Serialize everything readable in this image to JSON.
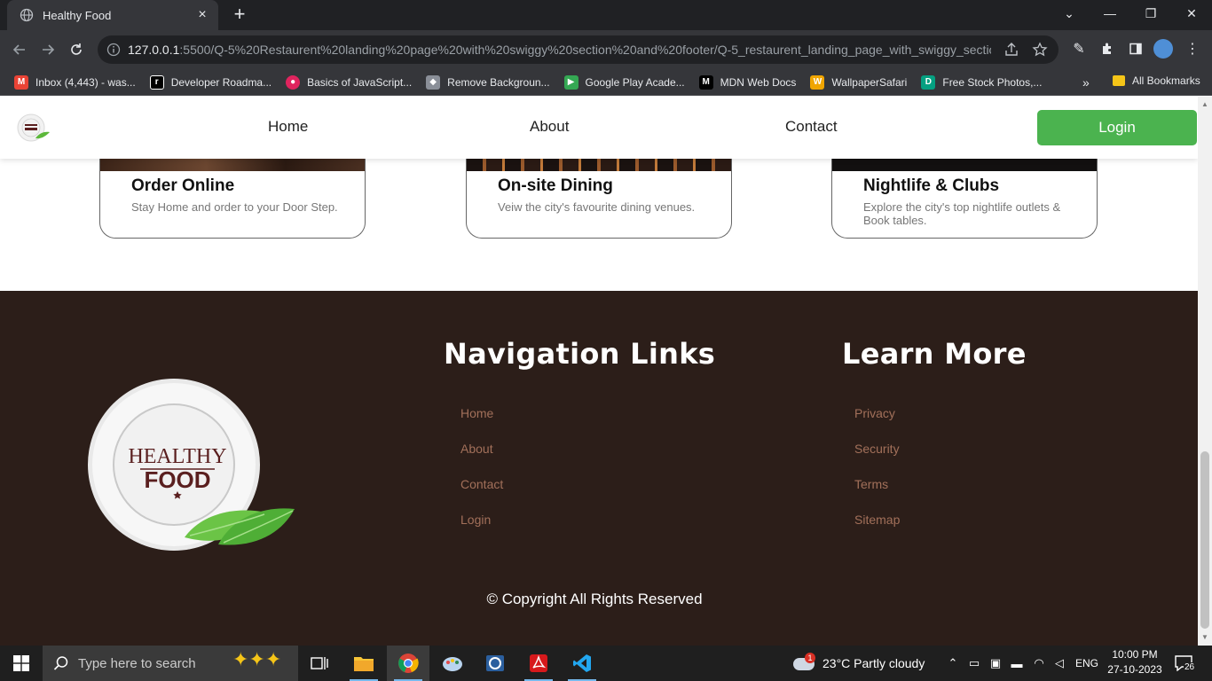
{
  "browser": {
    "tab_title": "Healthy Food",
    "url_host": "127.0.0.1",
    "url_rest": ":5500/Q-5%20Restaurent%20landing%20page%20with%20swiggy%20section%20and%20footer/Q-5_restaurent_landing_page_with_swiggy_section_...",
    "bookmarks": [
      {
        "label": "Inbox (4,443) - was...",
        "icon": "gmail-icon",
        "color": "#ea4335"
      },
      {
        "label": "Developer Roadma...",
        "icon": "roadmap-icon",
        "color": "#000000"
      },
      {
        "label": "Basics of JavaScript...",
        "icon": "js-basics-icon",
        "color": "#e0245e"
      },
      {
        "label": "Remove Backgroun...",
        "icon": "removebg-icon",
        "color": "#8a8f98"
      },
      {
        "label": "Google Play Acade...",
        "icon": "google-play-icon",
        "color": "#34a853"
      },
      {
        "label": "MDN Web Docs",
        "icon": "mdn-icon",
        "color": "#000000"
      },
      {
        "label": "WallpaperSafari",
        "icon": "wallpapersafari-icon",
        "color": "#f0a500"
      },
      {
        "label": "Free Stock Photos,...",
        "icon": "stock-photos-icon",
        "color": "#05a081"
      }
    ],
    "all_bookmarks": "All Bookmarks"
  },
  "site": {
    "nav": {
      "home": "Home",
      "about": "About",
      "contact": "Contact",
      "login": "Login"
    },
    "cards": [
      {
        "title": "Order Online",
        "desc": "Stay Home and order to your Door Step."
      },
      {
        "title": "On-site Dining",
        "desc": "Veiw the city's favourite dining venues."
      },
      {
        "title": "Nightlife & Clubs",
        "desc": "Explore the city's top nightlife outlets & Book tables."
      }
    ],
    "footer": {
      "logo_line1": "HEALTHY",
      "logo_line2": "FOOD",
      "nav_heading": "Navigation Links",
      "nav_links": [
        "Home",
        "About",
        "Contact",
        "Login"
      ],
      "learn_heading": "Learn More",
      "learn_links": [
        "Privacy",
        "Security",
        "Terms",
        "Sitemap"
      ],
      "copyright": "© Copyright All Rights Reserved"
    }
  },
  "taskbar": {
    "search_placeholder": "Type here to search",
    "weather": "23°C  Partly cloudy",
    "weather_badge": "1",
    "lang": "ENG",
    "time": "10:00 PM",
    "date": "27-10-2023",
    "notif_count": "26"
  },
  "colors": {
    "login_green": "#4bb34f",
    "footer_bg": "#2c1e19",
    "footer_link": "#a2705a"
  }
}
